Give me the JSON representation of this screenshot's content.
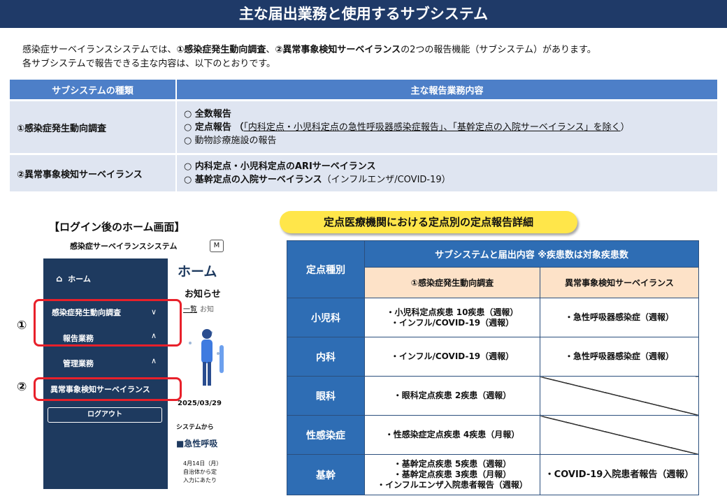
{
  "header": {
    "title": "主な届出業務と使用するサブシステム"
  },
  "intro": {
    "l1_a": "感染症サーベイランスシステムでは、",
    "l1_b": "①感染症発生動向調査",
    "l1_c": "、",
    "l1_d": "②異常事象検知サーベイランス",
    "l1_e": "の2つの報告機能（サブシステム）があります。",
    "line2": "各サブシステムで報告できる主な内容は、以下のとおりです。"
  },
  "subsystem_table": {
    "headers": [
      "サブシステムの種類",
      "主な報告業務内容"
    ],
    "row1": {
      "name": "①感染症発生動向調査",
      "c1": "○ 全数報告",
      "c2a": "○ 定点報告 （",
      "c2b": "「内科定点・小児科定点の急性呼吸器感染症報告」、「基幹定点の入院サーベイランス」を除く",
      "c2c": "）",
      "c3": "○ 動物診療施設の報告"
    },
    "row2": {
      "name": "②異常事象検知サーベイランス",
      "c1": "○ 内科定点・小児科定点のARIサーベイランス",
      "c2a": "○ 基幹定点の入院サーベイランス",
      "c2b": "（インフルエンザ/COVID-19）"
    }
  },
  "home_screen": {
    "caption": "【ログイン後のホーム画面】",
    "app_title": "感染症サーベイランスシステム",
    "app_title_box": "M",
    "sidebar": {
      "home": "ホーム",
      "item1": "感染症発生動向調査",
      "item1_sub": "報告業務",
      "item2": "管理業務",
      "item3": "異常事象検知サーベイランス",
      "logout": "ログアウト"
    },
    "main": {
      "heading": "ホーム",
      "notice": "お知らせ",
      "tab1": "一覧",
      "tab2": "お知",
      "date": "2025/03/29",
      "sys": "システムから",
      "news_title": "■急性呼吸",
      "news1": "4月14日（月）",
      "news2": "自治体から定",
      "news3": "入力にあたり"
    },
    "markers": [
      "①",
      "②"
    ]
  },
  "detail": {
    "pill_title": "定点医療機関における定点別の定点報告詳細",
    "header_kind": "定点種別",
    "header_group": "サブシステムと届出内容 ※疾患数は対象疾患数",
    "header_col1": "①感染症発生動向調査",
    "header_col2": "異常事象検知サーベイランス",
    "rows": [
      {
        "kind": "小児科",
        "col1": [
          "・小児科定点疾患 10疾患（週報）",
          "・インフル/COVID-19（週報）"
        ],
        "col2": "・急性呼吸器感染症（週報）"
      },
      {
        "kind": "内科",
        "col1": [
          "・インフル/COVID-19（週報）"
        ],
        "col2": "・急性呼吸器感染症（週報）"
      },
      {
        "kind": "眼科",
        "col1": [
          "・眼科定点疾患 2疾患（週報）"
        ],
        "col2": ""
      },
      {
        "kind": "性感染症",
        "col1": [
          "・性感染症定点疾患 4疾患（月報）"
        ],
        "col2": ""
      },
      {
        "kind": "基幹",
        "col1": [
          "・基幹定点疾患 5疾患（週報）",
          "・基幹定点疾患 3疾患（月報）",
          "・インフルエンザ入院患者報告（週報）"
        ],
        "col2": "・COVID-19入院患者報告（週報）"
      }
    ]
  }
}
